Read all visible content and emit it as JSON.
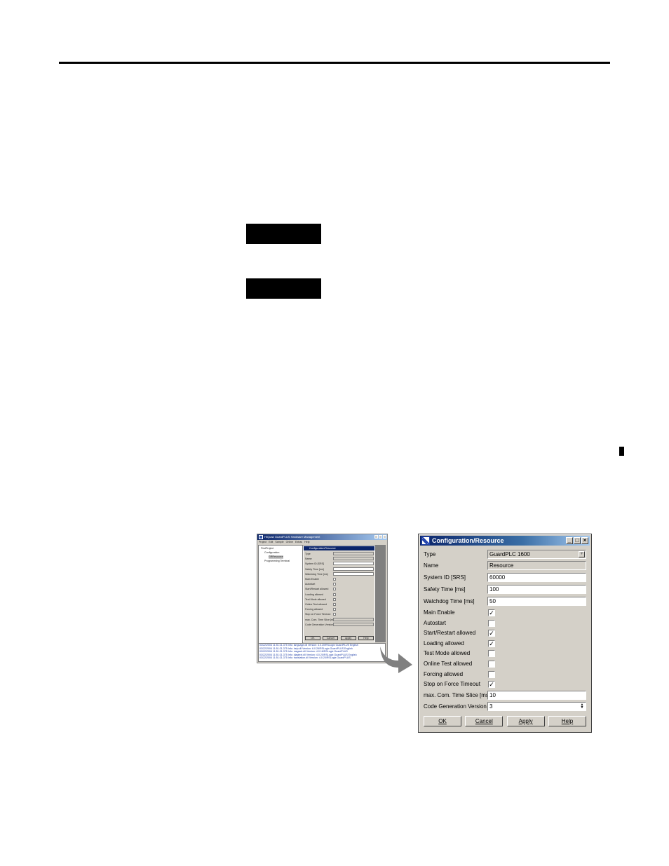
{
  "mini": {
    "app_title": "HIQuad GuardPLUS Hardware Management",
    "menu": [
      "Project",
      "Edit",
      "Sample",
      "Online",
      "Extras",
      "Help"
    ],
    "tree": [
      "FirstProject",
      "Configuration",
      "GRResource",
      "Programming Terminal"
    ],
    "dialog_title": "Configuration/Resource",
    "rows": [
      {
        "label": "Type",
        "kind": "field"
      },
      {
        "label": "Name",
        "kind": "field"
      },
      {
        "label": "System ID [SRS]",
        "kind": "field"
      },
      {
        "label": "Safety Time [ms]",
        "kind": "field"
      },
      {
        "label": "Watchdog Time [ms]",
        "kind": "field"
      },
      {
        "label": "Main Enable",
        "kind": "check"
      },
      {
        "label": "Autostart",
        "kind": "check"
      },
      {
        "label": "Start/Restart allowed",
        "kind": "check"
      },
      {
        "label": "Loading allowed",
        "kind": "check"
      },
      {
        "label": "Test Mode allowed",
        "kind": "check"
      },
      {
        "label": "Online Test allowed",
        "kind": "check"
      },
      {
        "label": "Forcing allowed",
        "kind": "check"
      },
      {
        "label": "Stop on Force Timeout",
        "kind": "check"
      },
      {
        "label": "max. Com. Time Slice [ms]",
        "kind": "field"
      },
      {
        "label": "Code Generation Version",
        "kind": "field"
      }
    ],
    "buttons": [
      "OK",
      "Cancel",
      "Apply",
      "Help"
    ],
    "log": [
      "03/22/2004 11:51:21.375 Info: language.dll Version: 4.0.20/RSLogix GuardPLUS English",
      "03/22/2004 11:51:21.375 Info: help.dll Version: 6.0.26/RSLogix GuardPLUS English",
      "03/22/2004 11:51:21.375 Info: msgsub.dll Version: 4.0.18/RSLogix GuardPLUS",
      "03/22/2004 11:51:21.375 Info: diagtext.dll Version: 4.0.20/RSLogix GuardPLUS English",
      "03/22/2004 11:51:21.375 Info: translation.dll Version: 4.0.20/RSLogix GuardPLUS"
    ]
  },
  "dialog": {
    "title": "Configuration/Resource",
    "type": {
      "label": "Type",
      "value": "GuardPLC 1600"
    },
    "name": {
      "label": "Name",
      "value": "Resource"
    },
    "system_id": {
      "label": "System ID [SRS]",
      "value": "60000"
    },
    "safety_time": {
      "label": "Safety Time [ms]",
      "value": "100"
    },
    "watchdog_time": {
      "label": "Watchdog Time [ms]",
      "value": "50"
    },
    "checks": [
      {
        "label": "Main Enable",
        "checked": true
      },
      {
        "label": "Autostart",
        "checked": false
      },
      {
        "label": "Start/Restart allowed",
        "checked": true
      },
      {
        "label": "Loading allowed",
        "checked": true
      },
      {
        "label": "Test Mode allowed",
        "checked": false
      },
      {
        "label": "Online Test allowed",
        "checked": false
      },
      {
        "label": "Forcing allowed",
        "checked": false
      },
      {
        "label": "Stop on Force Timeout",
        "checked": true
      }
    ],
    "time_slice": {
      "label": "max. Com. Time Slice [ms]",
      "value": "10"
    },
    "code_gen": {
      "label": "Code Generation Version",
      "value": "3"
    },
    "buttons": {
      "ok": "OK",
      "cancel": "Cancel",
      "apply": "Apply",
      "help": "Help"
    },
    "check_glyph": "✓"
  }
}
